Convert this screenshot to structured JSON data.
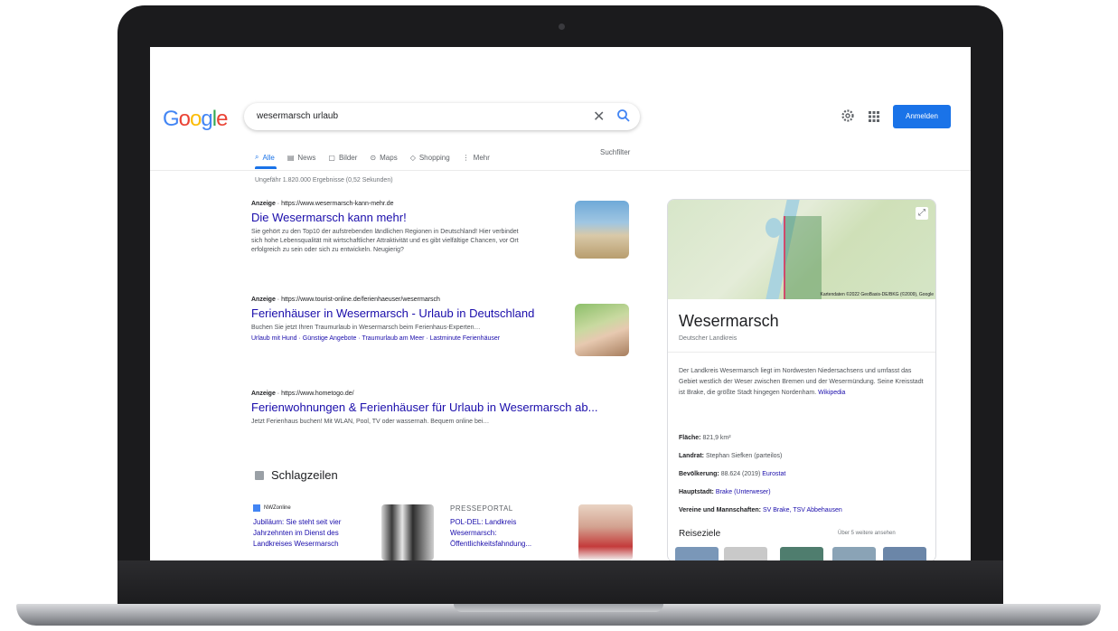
{
  "google": {
    "logo_letters": [
      "G",
      "o",
      "o",
      "g",
      "l",
      "e"
    ],
    "logo_colors": [
      "#4285f4",
      "#ea4335",
      "#fbbc05",
      "#4285f4",
      "#34a853",
      "#ea4335"
    ],
    "search_query": "wesermarsch urlaub",
    "clear_symbol": "✕",
    "signin_label": "Anmelden",
    "tabs": [
      {
        "label": "Alle",
        "icon": "search-icon"
      },
      {
        "label": "News",
        "icon": "news-icon"
      },
      {
        "label": "Bilder",
        "icon": "image-icon"
      },
      {
        "label": "Maps",
        "icon": "map-pin-icon"
      },
      {
        "label": "Shopping",
        "icon": "tag-icon"
      },
      {
        "label": "Mehr",
        "icon": "more-icon"
      }
    ],
    "tools_label": "Suchfilter",
    "result_stats": "Ungefähr 1.820.000 Ergebnisse (0,52 Sekunden)"
  },
  "results": [
    {
      "ad_label": "Anzeige",
      "url": "https://www.wesermarsch-kann-mehr.de",
      "title": "Die Wesermarsch kann mehr!",
      "desc": "Sie gehört zu den Top10 der aufstrebenden ländlichen Regionen in Deutschland! Hier verbindet sich hohe Lebensqualität mit wirtschaftlicher Attraktivität und es gibt vielfältige Chancen, vor Ort erfolgreich zu sein oder sich zu entwickeln. Neugierig?"
    },
    {
      "ad_label": "Anzeige",
      "url": "https://www.tourist-online.de/ferienhaeuser/wesermarsch",
      "title": "Ferienhäuser in Wesermarsch - Urlaub in Deutschland",
      "desc": "Buchen Sie jetzt Ihren Traumurlaub in Wesermarsch beim Ferienhaus-Experten…",
      "sitelinks": "Urlaub mit Hund · Günstige Angebote · Traumurlaub am Meer · Lastminute Ferienhäuser"
    },
    {
      "ad_label": "Anzeige",
      "url": "https://www.hometogo.de/",
      "title": "Ferienwohnungen & Ferienhäuser für Urlaub in Wesermarsch ab...",
      "desc": "Jetzt Ferienhaus buchen! Mit WLAN, Pool, TV oder wassernah. Bequem online bei…"
    }
  ],
  "news": {
    "heading": "Schlagzeilen",
    "items": [
      {
        "source": "NWZonline",
        "title": "Jubiläum: Sie steht seit vier Jahrzehnten im Dienst des Landkreises Wesermarsch"
      },
      {
        "source": "PRESSEPORTAL",
        "title": "POL-DEL: Landkreis Wesermarsch: Öffentlichkeitsfahndung..."
      }
    ]
  },
  "knowledge_panel": {
    "map_attribution": "Kartendaten ©2022 GeoBasis-DE/BKG (©2009), Google",
    "title": "Wesermarsch",
    "subtitle": "Deutscher Landkreis",
    "description": "Der Landkreis Wesermarsch liegt im Nordwesten Niedersachsens und umfasst das Gebiet westlich der Weser zwischen Bremen und der Wesermündung. Seine Kreisstadt ist Brake, die größte Stadt hingegen Nordenham.",
    "wiki_label": "Wikipedia",
    "facts": [
      {
        "label": "Fläche:",
        "value": "821,9 km²"
      },
      {
        "label": "Landrat:",
        "value": "Stephan Siefken (parteilos)"
      },
      {
        "label": "Bevölkerung:",
        "value": "88.624 (2019)",
        "link": "Eurostat"
      },
      {
        "label": "Hauptstadt:",
        "link": "Brake (Unterweser)"
      },
      {
        "label": "Vereine und Mannschaften:",
        "link": "SV Brake, TSV Abbehausen"
      }
    ],
    "reise_heading": "Reiseziele",
    "reise_more": "Über 5 weitere ansehen"
  }
}
